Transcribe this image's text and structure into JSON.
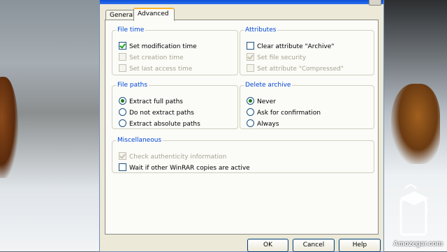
{
  "dialog": {
    "tabs": [
      {
        "label": "General",
        "active": false
      },
      {
        "label": "Advanced",
        "active": true
      }
    ],
    "file_time": {
      "legend": "File time",
      "options": [
        {
          "label": "Set modification time",
          "checked": true,
          "enabled": true
        },
        {
          "label": "Set creation time",
          "checked": false,
          "enabled": false
        },
        {
          "label": "Set last access time",
          "checked": false,
          "enabled": false
        }
      ]
    },
    "attributes": {
      "legend": "Attributes",
      "options": [
        {
          "label": "Clear attribute \"Archive\"",
          "checked": false,
          "enabled": true
        },
        {
          "label": "Set file security",
          "checked": true,
          "enabled": false
        },
        {
          "label": "Set attribute \"Compressed\"",
          "checked": false,
          "enabled": false
        }
      ]
    },
    "file_paths": {
      "legend": "File paths",
      "options": [
        {
          "label": "Extract full paths",
          "selected": true
        },
        {
          "label": "Do not extract paths",
          "selected": false
        },
        {
          "label": "Extract absolute paths",
          "selected": false
        }
      ]
    },
    "delete_archive": {
      "legend": "Delete archive",
      "options": [
        {
          "label": "Never",
          "selected": true
        },
        {
          "label": "Ask for confirmation",
          "selected": false
        },
        {
          "label": "Always",
          "selected": false
        }
      ]
    },
    "miscellaneous": {
      "legend": "Miscellaneous",
      "options": [
        {
          "label": "Check authenticity information",
          "checked": true,
          "enabled": false
        },
        {
          "label": "Wait if other WinRAR copies are active",
          "checked": false,
          "enabled": true
        }
      ]
    },
    "buttons": {
      "ok": "OK",
      "cancel": "Cancel",
      "help": "Help"
    }
  },
  "watermark": {
    "text": "Amozegar.com"
  },
  "colors": {
    "accent": "#0046d5",
    "tab_highlight": "#ffb52a",
    "dialog_bg": "#ece9d8"
  }
}
